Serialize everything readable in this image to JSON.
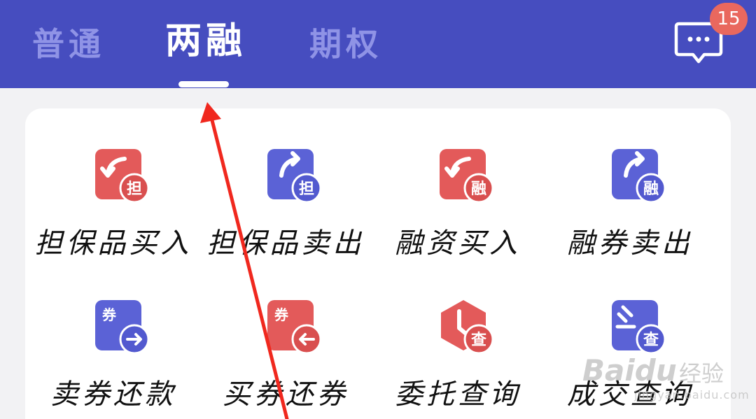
{
  "header": {
    "tabs": [
      {
        "label": "普通",
        "active": false
      },
      {
        "label": "两融",
        "active": true
      },
      {
        "label": "期权",
        "active": false
      }
    ],
    "message_icon": "chat-bubble-icon",
    "badge_count": "15",
    "colors": {
      "bar": "#464dbf",
      "badge": "#e9685e"
    }
  },
  "grid": {
    "items": [
      {
        "label": "担保品买入",
        "icon": "red-arrow-back-icon",
        "badge": "担",
        "color": "red"
      },
      {
        "label": "担保品卖出",
        "icon": "blue-arrow-forward-icon",
        "badge": "担",
        "color": "blue"
      },
      {
        "label": "融资买入",
        "icon": "red-arrow-back-icon",
        "badge": "融",
        "color": "red"
      },
      {
        "label": "融券卖出",
        "icon": "blue-arrow-forward-icon",
        "badge": "融",
        "color": "blue"
      },
      {
        "label": "卖券还款",
        "icon": "blue-arrow-right-circle-icon",
        "tag": "券",
        "color": "blue"
      },
      {
        "label": "买券还券",
        "icon": "red-arrow-left-circle-icon",
        "tag": "券",
        "color": "red"
      },
      {
        "label": "委托查询",
        "icon": "red-clock-hexagon-icon",
        "badge": "查",
        "color": "red"
      },
      {
        "label": "成交查询",
        "icon": "blue-gavel-icon",
        "badge": "查",
        "color": "blue"
      }
    ]
  },
  "watermark": {
    "brand": "Baidu",
    "sub": "经验",
    "url": "jingyan.baidu.com"
  }
}
